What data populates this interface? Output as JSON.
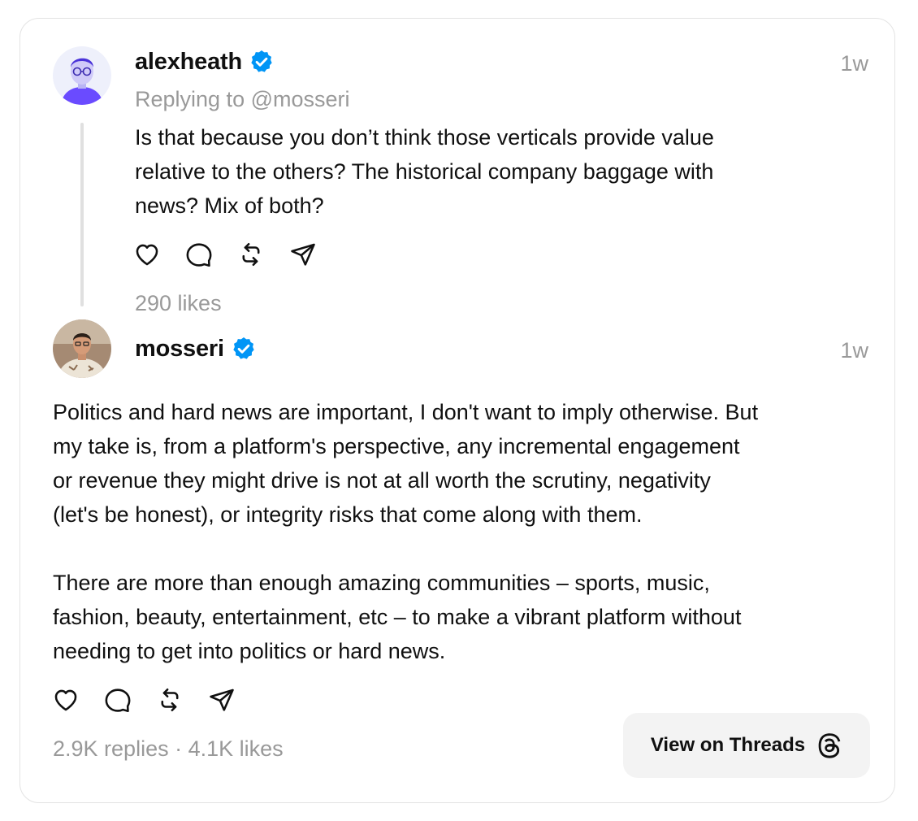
{
  "reply_post": {
    "username": "alexheath",
    "verified_icon": "verified-badge-icon",
    "time": "1w",
    "replying_to": "Replying to @mosseri",
    "text": "Is that because you don’t think those verticals provide value\nrelative to the others? The historical company baggage with\nnews? Mix of both?",
    "likes": "290 likes",
    "actions": [
      "heart-icon",
      "comment-icon",
      "repost-icon",
      "share-icon"
    ]
  },
  "main_post": {
    "username": "mosseri",
    "verified_icon": "verified-badge-icon",
    "time": "1w",
    "text": "Politics and hard news are important, I don't want to imply otherwise. But\nmy take is, from a platform's perspective, any incremental engagement\nor revenue they might drive is not at all worth the scrutiny, negativity\n(let's be honest), or integrity risks that come along with them.\n\nThere are more than enough amazing communities – sports, music,\nfashion, beauty, entertainment, etc – to make a vibrant platform without\nneeding to get into politics or hard news.",
    "stats": "2.9K replies · 4.1K likes",
    "actions": [
      "heart-icon",
      "comment-icon",
      "repost-icon",
      "share-icon"
    ]
  },
  "view_button": {
    "label": "View on Threads",
    "icon": "threads-logo-icon"
  },
  "colors": {
    "verified": "#0095F6",
    "muted": "#999999",
    "thread_line": "#E0E0E0",
    "button_bg": "#F3F3F3"
  }
}
